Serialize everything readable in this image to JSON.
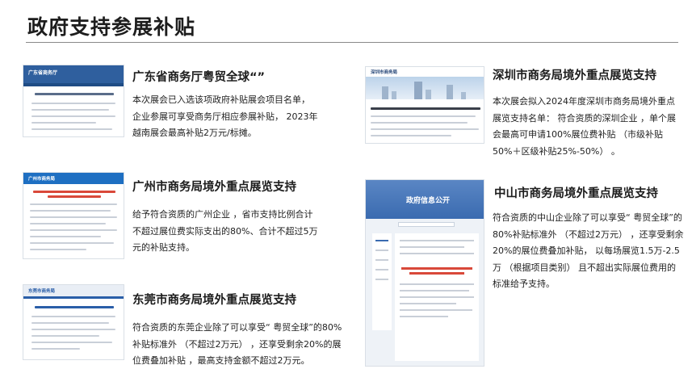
{
  "page": {
    "title": "政府支持参展补贴"
  },
  "cards": [
    {
      "thumb_logo": "广东省商务厅",
      "title": "广东省商务厅粤贸全球“”",
      "lines": [
        "本次展会已入选该项政府补贴展会项目名单，",
        "企业参展可享受商务厅相应参展补贴， 2023年",
        "越南展会最高补贴2万元/标摊。"
      ]
    },
    {
      "thumb_logo": "广州市商务局",
      "title": "广州市商务局境外重点展览支持",
      "lines": [
        "给予符合资质的广州企业 ，省市支持比例合计",
        "不超过展位费实际支出的80%、合计不超过5万",
        "元的补贴支持。"
      ]
    },
    {
      "thumb_logo": "东莞市商务局",
      "title": "东莞市商务局境外重点展览支持",
      "lines": [
        "符合资质的东莞企业除了可以享受“ 粤贸全球”的80%",
        "补贴标准外 （不超过2万元） ，还享受剩余20%的展",
        "位费叠加补贴 ，最高支持金额不超过2万元。"
      ]
    },
    {
      "thumb_logo": "深圳市商务局",
      "title": "深圳市商务局境外重点展览支持",
      "lines": [
        "本次展会拟入2024年度深圳市商务局境外重点",
        "展览支持名单： 符合资质的深圳企业 ，单个展",
        "会最高可申请100%展位费补贴 （市级补贴",
        "50%＋区级补贴25%-50%） 。"
      ]
    },
    {
      "thumb_logo": "政府信息公开",
      "title": "中山市商务局境外重点展览支持",
      "lines": [
        "符合资质的中山企业除了可以享受“ 粤贸全球”的",
        "80%补贴标准外 （不超过2万元） ，还享受剩余",
        "20%的展位费叠加补贴， 以每场展览1.5万-2.5",
        "万 （根据项目类别） 且不超出实际展位费用的",
        "标准给予支持。"
      ]
    }
  ],
  "colors": {
    "gd_header": "#2f5f9e",
    "gz_header": "#1e6fc2",
    "dg_header": "#e9eef5",
    "sz_header": "#ffffff",
    "zs_header": "#3a6bb0"
  }
}
